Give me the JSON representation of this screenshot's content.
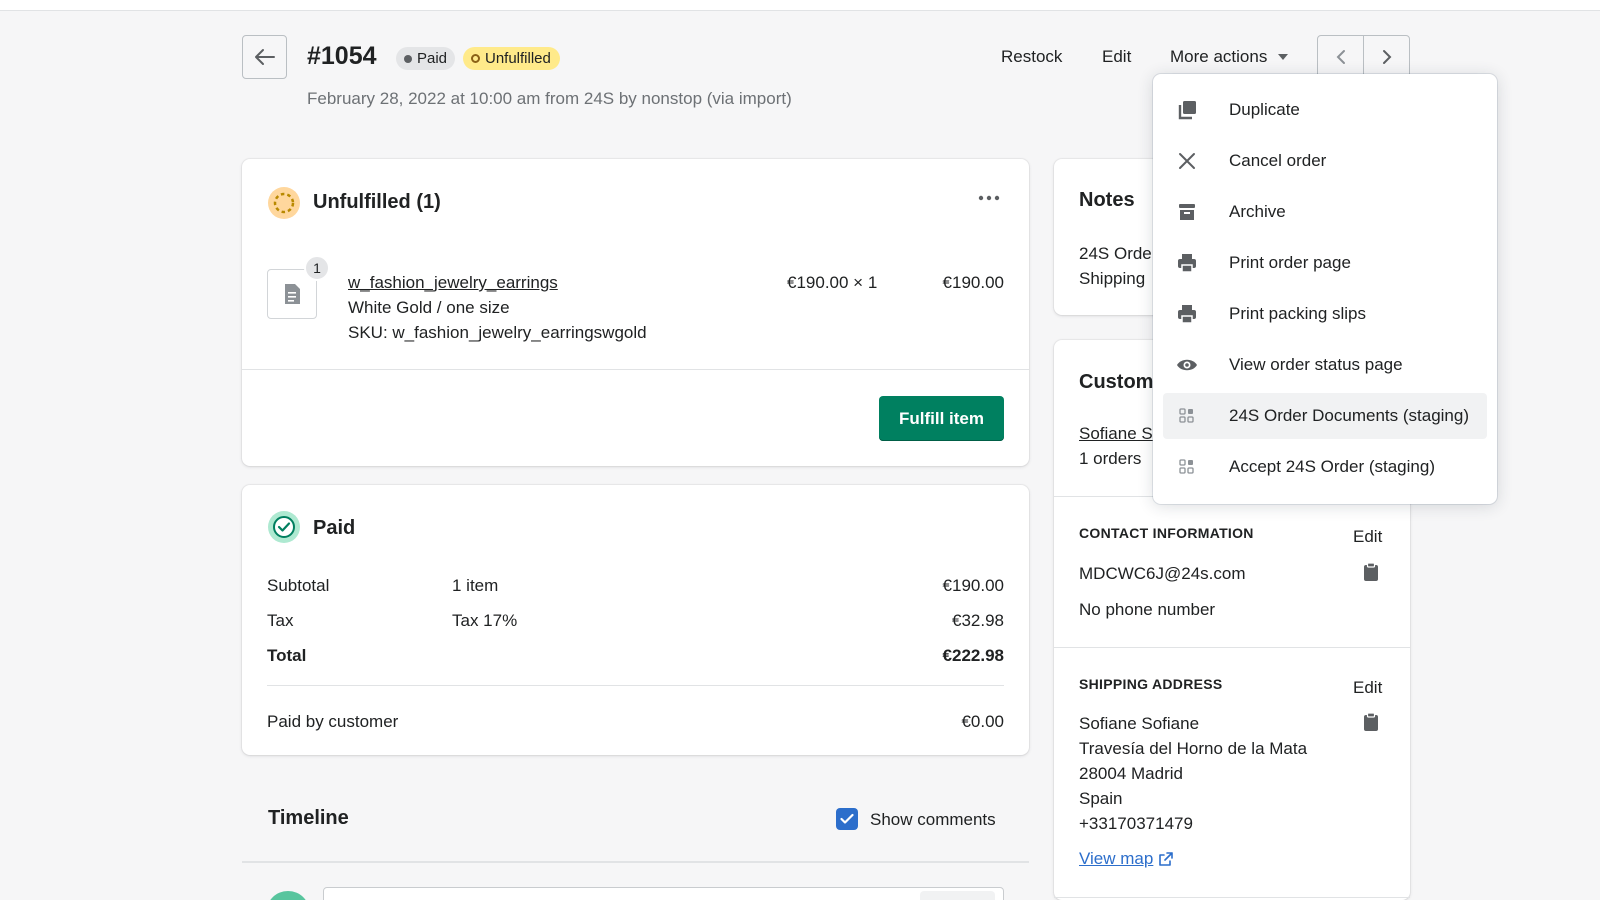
{
  "header": {
    "order_number": "#1054",
    "badge_paid": "Paid",
    "badge_unfulfilled": "Unfulfilled",
    "subtitle": "February 28, 2022 at 10:00 am from 24S by nonstop (via import)",
    "restock": "Restock",
    "edit": "Edit",
    "more_actions": "More actions"
  },
  "unfulfilled": {
    "title": "Unfulfilled (1)",
    "item": {
      "qty_badge": "1",
      "name": "w_fashion_jewelry_earrings",
      "variant": "White Gold / one size",
      "sku": "SKU: w_fashion_jewelry_earringswgold",
      "unit_price": "€190.00 × 1",
      "total": "€190.00"
    },
    "fulfill_button": "Fulfill item"
  },
  "paid": {
    "title": "Paid",
    "rows": [
      {
        "label": "Subtotal",
        "detail": "1 item",
        "amount": "€190.00"
      },
      {
        "label": "Tax",
        "detail": "Tax 17%",
        "amount": "€32.98"
      },
      {
        "label": "Total",
        "detail": "",
        "amount": "€222.98"
      }
    ],
    "paid_by_label": "Paid by customer",
    "paid_by_amount": "€0.00"
  },
  "timeline": {
    "title": "Timeline",
    "show_comments": "Show comments",
    "show_comments_checked": true
  },
  "notes": {
    "title": "Notes",
    "line1": "24S Orde",
    "line2": "Shipping"
  },
  "customer": {
    "title": "Custom",
    "name_link": "Sofiane S",
    "orders": "1 orders",
    "contact_title": "CONTACT INFORMATION",
    "contact_edit": "Edit",
    "email": "MDCWC6J@24s.com",
    "phone": "No phone number",
    "shipping_title": "SHIPPING ADDRESS",
    "shipping_edit": "Edit",
    "address": {
      "name": "Sofiane Sofiane",
      "street": "Travesía del Horno de la Mata",
      "city": "28004 Madrid",
      "country": "Spain",
      "phone": "+33170371479"
    },
    "view_map": "View map"
  },
  "more_actions_menu": {
    "items": [
      {
        "label": "Duplicate",
        "icon": "duplicate-icon"
      },
      {
        "label": "Cancel order",
        "icon": "close-icon"
      },
      {
        "label": "Archive",
        "icon": "archive-icon"
      },
      {
        "label": "Print order page",
        "icon": "print-icon"
      },
      {
        "label": "Print packing slips",
        "icon": "print-icon"
      },
      {
        "label": "View order status page",
        "icon": "eye-icon"
      },
      {
        "label": "24S Order Documents (staging)",
        "icon": "app-icon"
      },
      {
        "label": "Accept 24S Order (staging)",
        "icon": "app-icon"
      }
    ]
  },
  "colors": {
    "primary_green": "#008060",
    "link_blue": "#2c6ecb",
    "unfulfilled_yellow": "#ffea8a",
    "paid_badge": "#e4e5e7"
  }
}
